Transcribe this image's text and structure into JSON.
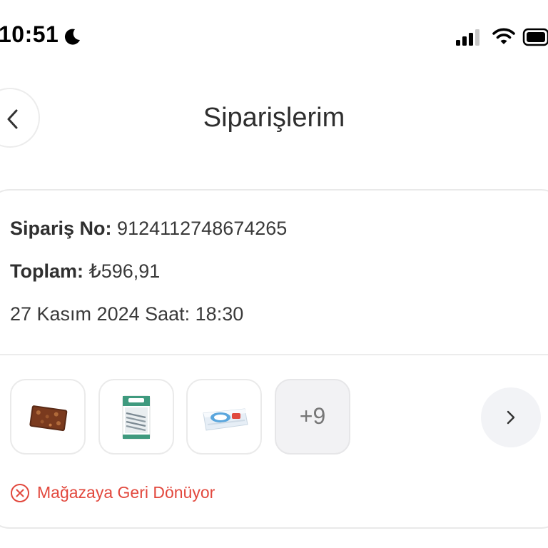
{
  "status_bar": {
    "time": "10:51",
    "icons": [
      "moon-icon",
      "cellular-signal-icon",
      "wifi-icon",
      "battery-icon"
    ]
  },
  "header": {
    "title": "Siparişlerim",
    "back_icon": "chevron-left-icon"
  },
  "order": {
    "order_no_label": "Sipariş No:",
    "order_no_value": "9124112748674265",
    "total_label": "Toplam:",
    "total_value": "₺596,91",
    "datetime": "27 Kasım 2024 Saat: 18:30",
    "products": [
      {
        "icon": "chocolate-bar-product-icon"
      },
      {
        "icon": "anchovy-fish-pack-product-icon"
      },
      {
        "icon": "cream-cheese-tub-product-icon"
      }
    ],
    "more_count": "+9",
    "next_icon": "chevron-right-icon",
    "status": {
      "icon": "circle-x-icon",
      "text": "Mağazaya Geri Dönüyor",
      "color": "#e2483d"
    }
  }
}
